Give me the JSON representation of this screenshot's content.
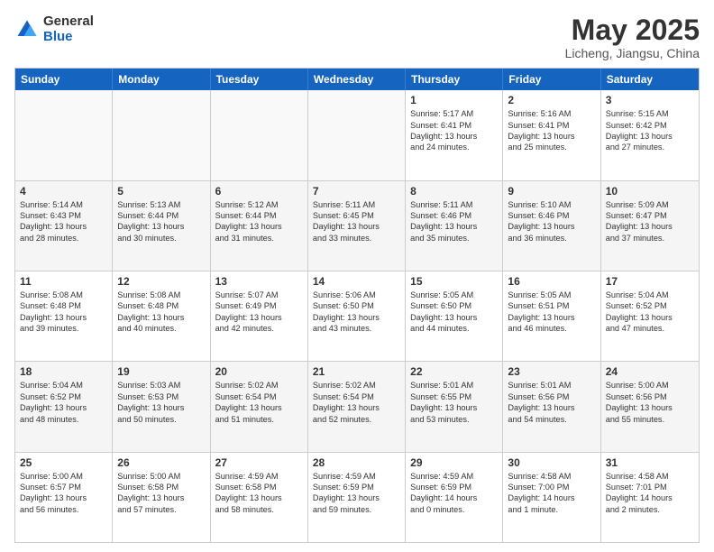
{
  "logo": {
    "general": "General",
    "blue": "Blue"
  },
  "header": {
    "title": "May 2025",
    "subtitle": "Licheng, Jiangsu, China"
  },
  "days": [
    "Sunday",
    "Monday",
    "Tuesday",
    "Wednesday",
    "Thursday",
    "Friday",
    "Saturday"
  ],
  "rows": [
    [
      {
        "day": "",
        "info": ""
      },
      {
        "day": "",
        "info": ""
      },
      {
        "day": "",
        "info": ""
      },
      {
        "day": "",
        "info": ""
      },
      {
        "day": "1",
        "info": "Sunrise: 5:17 AM\nSunset: 6:41 PM\nDaylight: 13 hours\nand 24 minutes."
      },
      {
        "day": "2",
        "info": "Sunrise: 5:16 AM\nSunset: 6:41 PM\nDaylight: 13 hours\nand 25 minutes."
      },
      {
        "day": "3",
        "info": "Sunrise: 5:15 AM\nSunset: 6:42 PM\nDaylight: 13 hours\nand 27 minutes."
      }
    ],
    [
      {
        "day": "4",
        "info": "Sunrise: 5:14 AM\nSunset: 6:43 PM\nDaylight: 13 hours\nand 28 minutes."
      },
      {
        "day": "5",
        "info": "Sunrise: 5:13 AM\nSunset: 6:44 PM\nDaylight: 13 hours\nand 30 minutes."
      },
      {
        "day": "6",
        "info": "Sunrise: 5:12 AM\nSunset: 6:44 PM\nDaylight: 13 hours\nand 31 minutes."
      },
      {
        "day": "7",
        "info": "Sunrise: 5:11 AM\nSunset: 6:45 PM\nDaylight: 13 hours\nand 33 minutes."
      },
      {
        "day": "8",
        "info": "Sunrise: 5:11 AM\nSunset: 6:46 PM\nDaylight: 13 hours\nand 35 minutes."
      },
      {
        "day": "9",
        "info": "Sunrise: 5:10 AM\nSunset: 6:46 PM\nDaylight: 13 hours\nand 36 minutes."
      },
      {
        "day": "10",
        "info": "Sunrise: 5:09 AM\nSunset: 6:47 PM\nDaylight: 13 hours\nand 37 minutes."
      }
    ],
    [
      {
        "day": "11",
        "info": "Sunrise: 5:08 AM\nSunset: 6:48 PM\nDaylight: 13 hours\nand 39 minutes."
      },
      {
        "day": "12",
        "info": "Sunrise: 5:08 AM\nSunset: 6:48 PM\nDaylight: 13 hours\nand 40 minutes."
      },
      {
        "day": "13",
        "info": "Sunrise: 5:07 AM\nSunset: 6:49 PM\nDaylight: 13 hours\nand 42 minutes."
      },
      {
        "day": "14",
        "info": "Sunrise: 5:06 AM\nSunset: 6:50 PM\nDaylight: 13 hours\nand 43 minutes."
      },
      {
        "day": "15",
        "info": "Sunrise: 5:05 AM\nSunset: 6:50 PM\nDaylight: 13 hours\nand 44 minutes."
      },
      {
        "day": "16",
        "info": "Sunrise: 5:05 AM\nSunset: 6:51 PM\nDaylight: 13 hours\nand 46 minutes."
      },
      {
        "day": "17",
        "info": "Sunrise: 5:04 AM\nSunset: 6:52 PM\nDaylight: 13 hours\nand 47 minutes."
      }
    ],
    [
      {
        "day": "18",
        "info": "Sunrise: 5:04 AM\nSunset: 6:52 PM\nDaylight: 13 hours\nand 48 minutes."
      },
      {
        "day": "19",
        "info": "Sunrise: 5:03 AM\nSunset: 6:53 PM\nDaylight: 13 hours\nand 50 minutes."
      },
      {
        "day": "20",
        "info": "Sunrise: 5:02 AM\nSunset: 6:54 PM\nDaylight: 13 hours\nand 51 minutes."
      },
      {
        "day": "21",
        "info": "Sunrise: 5:02 AM\nSunset: 6:54 PM\nDaylight: 13 hours\nand 52 minutes."
      },
      {
        "day": "22",
        "info": "Sunrise: 5:01 AM\nSunset: 6:55 PM\nDaylight: 13 hours\nand 53 minutes."
      },
      {
        "day": "23",
        "info": "Sunrise: 5:01 AM\nSunset: 6:56 PM\nDaylight: 13 hours\nand 54 minutes."
      },
      {
        "day": "24",
        "info": "Sunrise: 5:00 AM\nSunset: 6:56 PM\nDaylight: 13 hours\nand 55 minutes."
      }
    ],
    [
      {
        "day": "25",
        "info": "Sunrise: 5:00 AM\nSunset: 6:57 PM\nDaylight: 13 hours\nand 56 minutes."
      },
      {
        "day": "26",
        "info": "Sunrise: 5:00 AM\nSunset: 6:58 PM\nDaylight: 13 hours\nand 57 minutes."
      },
      {
        "day": "27",
        "info": "Sunrise: 4:59 AM\nSunset: 6:58 PM\nDaylight: 13 hours\nand 58 minutes."
      },
      {
        "day": "28",
        "info": "Sunrise: 4:59 AM\nSunset: 6:59 PM\nDaylight: 13 hours\nand 59 minutes."
      },
      {
        "day": "29",
        "info": "Sunrise: 4:59 AM\nSunset: 6:59 PM\nDaylight: 14 hours\nand 0 minutes."
      },
      {
        "day": "30",
        "info": "Sunrise: 4:58 AM\nSunset: 7:00 PM\nDaylight: 14 hours\nand 1 minute."
      },
      {
        "day": "31",
        "info": "Sunrise: 4:58 AM\nSunset: 7:01 PM\nDaylight: 14 hours\nand 2 minutes."
      }
    ]
  ]
}
